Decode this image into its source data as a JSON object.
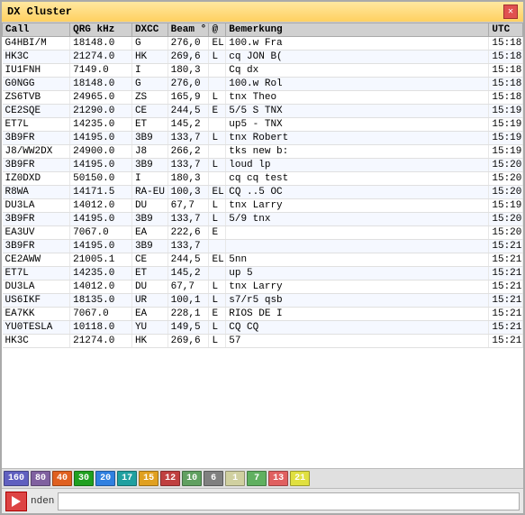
{
  "window": {
    "title": "DX Cluster",
    "close_label": "✕"
  },
  "table": {
    "columns": [
      {
        "key": "call",
        "label": "Call",
        "class": "col-call"
      },
      {
        "key": "qrg",
        "label": "QRG kHz",
        "class": "col-qrg"
      },
      {
        "key": "dxcc",
        "label": "DXCC",
        "class": "col-dxcc"
      },
      {
        "key": "beam",
        "label": "Beam °",
        "class": "col-beam"
      },
      {
        "key": "at",
        "label": "@",
        "class": "col-at"
      },
      {
        "key": "remark",
        "label": "Bemerkung",
        "class": "col-remark"
      },
      {
        "key": "utc",
        "label": "UTC",
        "class": "col-utc"
      }
    ],
    "rows": [
      {
        "call": "G4HBI/M",
        "qrg": "18148.0",
        "dxcc": "G",
        "beam": "276,0",
        "at": "EL",
        "remark": "100.w Fra",
        "utc": "15:18"
      },
      {
        "call": "HK3C",
        "qrg": "21274.0",
        "dxcc": "HK",
        "beam": "269,6",
        "at": "L",
        "remark": "cq JON B(",
        "utc": "15:18"
      },
      {
        "call": "IU1FNH",
        "qrg": "7149.0",
        "dxcc": "I",
        "beam": "180,3",
        "at": "",
        "remark": "Cq dx",
        "utc": "15:18"
      },
      {
        "call": "G0NGG",
        "qrg": "18148.0",
        "dxcc": "G",
        "beam": "276,0",
        "at": "",
        "remark": "100.w Rol",
        "utc": "15:18"
      },
      {
        "call": "ZS6TVB",
        "qrg": "24965.0",
        "dxcc": "ZS",
        "beam": "165,9",
        "at": "L",
        "remark": "tnx Theo",
        "utc": "15:18"
      },
      {
        "call": "CE2SQE",
        "qrg": "21290.0",
        "dxcc": "CE",
        "beam": "244,5",
        "at": "E",
        "remark": "5/5 S TNX",
        "utc": "15:19"
      },
      {
        "call": "ET7L",
        "qrg": "14235.0",
        "dxcc": "ET",
        "beam": "145,2",
        "at": "",
        "remark": "up5 - TNX",
        "utc": "15:19"
      },
      {
        "call": "3B9FR",
        "qrg": "14195.0",
        "dxcc": "3B9",
        "beam": "133,7",
        "at": "L",
        "remark": "tnx Robert",
        "utc": "15:19"
      },
      {
        "call": "J8/WW2DX",
        "qrg": "24900.0",
        "dxcc": "J8",
        "beam": "266,2",
        "at": "",
        "remark": "tks new b:",
        "utc": "15:19"
      },
      {
        "call": "3B9FR",
        "qrg": "14195.0",
        "dxcc": "3B9",
        "beam": "133,7",
        "at": "L",
        "remark": "loud lp",
        "utc": "15:20"
      },
      {
        "call": "IZ0DXD",
        "qrg": "50150.0",
        "dxcc": "I",
        "beam": "180,3",
        "at": "",
        "remark": "cq cq test",
        "utc": "15:20"
      },
      {
        "call": "R8WA",
        "qrg": "14171.5",
        "dxcc": "RA-EU",
        "beam": "100,3",
        "at": "EL",
        "remark": "CQ ..5 OC",
        "utc": "15:20"
      },
      {
        "call": "DU3LA",
        "qrg": "14012.0",
        "dxcc": "DU",
        "beam": "67,7",
        "at": "L",
        "remark": "tnx Larry",
        "utc": "15:19"
      },
      {
        "call": "3B9FR",
        "qrg": "14195.0",
        "dxcc": "3B9",
        "beam": "133,7",
        "at": "L",
        "remark": "5/9 tnx",
        "utc": "15:20"
      },
      {
        "call": "EA3UV",
        "qrg": "7067.0",
        "dxcc": "EA",
        "beam": "222,6",
        "at": "E",
        "remark": "",
        "utc": "15:20"
      },
      {
        "call": "3B9FR",
        "qrg": "14195.0",
        "dxcc": "3B9",
        "beam": "133,7",
        "at": "",
        "remark": "",
        "utc": "15:21"
      },
      {
        "call": "CE2AWW",
        "qrg": "21005.1",
        "dxcc": "CE",
        "beam": "244,5",
        "at": "EL",
        "remark": "5nn",
        "utc": "15:21"
      },
      {
        "call": "ET7L",
        "qrg": "14235.0",
        "dxcc": "ET",
        "beam": "145,2",
        "at": "",
        "remark": "up 5",
        "utc": "15:21"
      },
      {
        "call": "DU3LA",
        "qrg": "14012.0",
        "dxcc": "DU",
        "beam": "67,7",
        "at": "L",
        "remark": "tnx Larry",
        "utc": "15:21"
      },
      {
        "call": "US6IKF",
        "qrg": "18135.0",
        "dxcc": "UR",
        "beam": "100,1",
        "at": "L",
        "remark": "s7/r5 qsb",
        "utc": "15:21"
      },
      {
        "call": "EA7KK",
        "qrg": "7067.0",
        "dxcc": "EA",
        "beam": "228,1",
        "at": "E",
        "remark": "RIOS DE I",
        "utc": "15:21"
      },
      {
        "call": "YU0TESLA",
        "qrg": "10118.0",
        "dxcc": "YU",
        "beam": "149,5",
        "at": "L",
        "remark": "CQ CQ",
        "utc": "15:21"
      },
      {
        "call": "HK3C",
        "qrg": "21274.0",
        "dxcc": "HK",
        "beam": "269,6",
        "at": "L",
        "remark": "57",
        "utc": "15:21"
      }
    ]
  },
  "bands": [
    {
      "label": "160",
      "color": "#6060c0"
    },
    {
      "label": "80",
      "color": "#8060a0"
    },
    {
      "label": "40",
      "color": "#e06020"
    },
    {
      "label": "30",
      "color": "#20a020"
    },
    {
      "label": "20",
      "color": "#3080e0"
    },
    {
      "label": "17",
      "color": "#20a0a0"
    },
    {
      "label": "15",
      "color": "#e0a020"
    },
    {
      "label": "12",
      "color": "#c04040"
    },
    {
      "label": "10",
      "color": "#60a060"
    },
    {
      "label": "6",
      "color": "#808080"
    },
    {
      "label": "1",
      "color": "#d0d0a0"
    },
    {
      "label": "7",
      "color": "#60b060"
    },
    {
      "label": "13",
      "color": "#e06060"
    },
    {
      "label": "21",
      "color": "#e0e040"
    }
  ],
  "bottom": {
    "status_text": "nden",
    "input_placeholder": ""
  }
}
